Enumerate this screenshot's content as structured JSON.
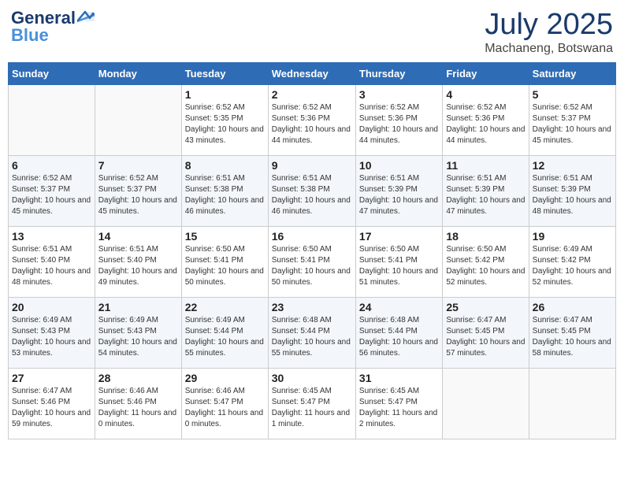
{
  "header": {
    "logo_general": "General",
    "logo_blue": "Blue",
    "month": "July 2025",
    "location": "Machaneng, Botswana"
  },
  "days_of_week": [
    "Sunday",
    "Monday",
    "Tuesday",
    "Wednesday",
    "Thursday",
    "Friday",
    "Saturday"
  ],
  "weeks": [
    [
      {
        "day": "",
        "info": ""
      },
      {
        "day": "",
        "info": ""
      },
      {
        "day": "1",
        "info": "Sunrise: 6:52 AM\nSunset: 5:35 PM\nDaylight: 10 hours and 43 minutes."
      },
      {
        "day": "2",
        "info": "Sunrise: 6:52 AM\nSunset: 5:36 PM\nDaylight: 10 hours and 44 minutes."
      },
      {
        "day": "3",
        "info": "Sunrise: 6:52 AM\nSunset: 5:36 PM\nDaylight: 10 hours and 44 minutes."
      },
      {
        "day": "4",
        "info": "Sunrise: 6:52 AM\nSunset: 5:36 PM\nDaylight: 10 hours and 44 minutes."
      },
      {
        "day": "5",
        "info": "Sunrise: 6:52 AM\nSunset: 5:37 PM\nDaylight: 10 hours and 45 minutes."
      }
    ],
    [
      {
        "day": "6",
        "info": "Sunrise: 6:52 AM\nSunset: 5:37 PM\nDaylight: 10 hours and 45 minutes."
      },
      {
        "day": "7",
        "info": "Sunrise: 6:52 AM\nSunset: 5:37 PM\nDaylight: 10 hours and 45 minutes."
      },
      {
        "day": "8",
        "info": "Sunrise: 6:51 AM\nSunset: 5:38 PM\nDaylight: 10 hours and 46 minutes."
      },
      {
        "day": "9",
        "info": "Sunrise: 6:51 AM\nSunset: 5:38 PM\nDaylight: 10 hours and 46 minutes."
      },
      {
        "day": "10",
        "info": "Sunrise: 6:51 AM\nSunset: 5:39 PM\nDaylight: 10 hours and 47 minutes."
      },
      {
        "day": "11",
        "info": "Sunrise: 6:51 AM\nSunset: 5:39 PM\nDaylight: 10 hours and 47 minutes."
      },
      {
        "day": "12",
        "info": "Sunrise: 6:51 AM\nSunset: 5:39 PM\nDaylight: 10 hours and 48 minutes."
      }
    ],
    [
      {
        "day": "13",
        "info": "Sunrise: 6:51 AM\nSunset: 5:40 PM\nDaylight: 10 hours and 48 minutes."
      },
      {
        "day": "14",
        "info": "Sunrise: 6:51 AM\nSunset: 5:40 PM\nDaylight: 10 hours and 49 minutes."
      },
      {
        "day": "15",
        "info": "Sunrise: 6:50 AM\nSunset: 5:41 PM\nDaylight: 10 hours and 50 minutes."
      },
      {
        "day": "16",
        "info": "Sunrise: 6:50 AM\nSunset: 5:41 PM\nDaylight: 10 hours and 50 minutes."
      },
      {
        "day": "17",
        "info": "Sunrise: 6:50 AM\nSunset: 5:41 PM\nDaylight: 10 hours and 51 minutes."
      },
      {
        "day": "18",
        "info": "Sunrise: 6:50 AM\nSunset: 5:42 PM\nDaylight: 10 hours and 52 minutes."
      },
      {
        "day": "19",
        "info": "Sunrise: 6:49 AM\nSunset: 5:42 PM\nDaylight: 10 hours and 52 minutes."
      }
    ],
    [
      {
        "day": "20",
        "info": "Sunrise: 6:49 AM\nSunset: 5:43 PM\nDaylight: 10 hours and 53 minutes."
      },
      {
        "day": "21",
        "info": "Sunrise: 6:49 AM\nSunset: 5:43 PM\nDaylight: 10 hours and 54 minutes."
      },
      {
        "day": "22",
        "info": "Sunrise: 6:49 AM\nSunset: 5:44 PM\nDaylight: 10 hours and 55 minutes."
      },
      {
        "day": "23",
        "info": "Sunrise: 6:48 AM\nSunset: 5:44 PM\nDaylight: 10 hours and 55 minutes."
      },
      {
        "day": "24",
        "info": "Sunrise: 6:48 AM\nSunset: 5:44 PM\nDaylight: 10 hours and 56 minutes."
      },
      {
        "day": "25",
        "info": "Sunrise: 6:47 AM\nSunset: 5:45 PM\nDaylight: 10 hours and 57 minutes."
      },
      {
        "day": "26",
        "info": "Sunrise: 6:47 AM\nSunset: 5:45 PM\nDaylight: 10 hours and 58 minutes."
      }
    ],
    [
      {
        "day": "27",
        "info": "Sunrise: 6:47 AM\nSunset: 5:46 PM\nDaylight: 10 hours and 59 minutes."
      },
      {
        "day": "28",
        "info": "Sunrise: 6:46 AM\nSunset: 5:46 PM\nDaylight: 11 hours and 0 minutes."
      },
      {
        "day": "29",
        "info": "Sunrise: 6:46 AM\nSunset: 5:47 PM\nDaylight: 11 hours and 0 minutes."
      },
      {
        "day": "30",
        "info": "Sunrise: 6:45 AM\nSunset: 5:47 PM\nDaylight: 11 hours and 1 minute."
      },
      {
        "day": "31",
        "info": "Sunrise: 6:45 AM\nSunset: 5:47 PM\nDaylight: 11 hours and 2 minutes."
      },
      {
        "day": "",
        "info": ""
      },
      {
        "day": "",
        "info": ""
      }
    ]
  ]
}
